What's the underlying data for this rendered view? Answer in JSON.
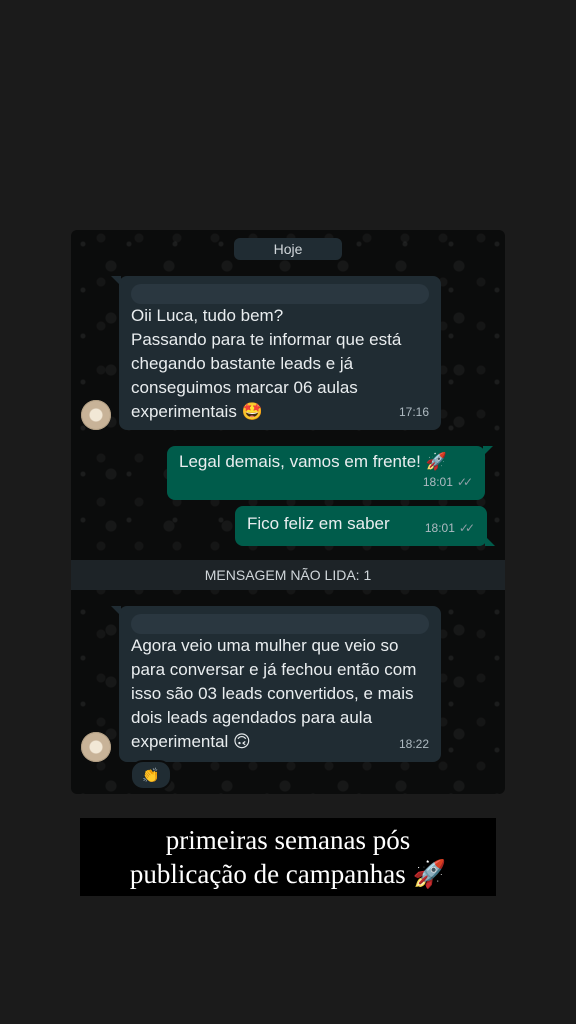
{
  "chat": {
    "date_label": "Hoje",
    "messages": [
      {
        "direction": "incoming",
        "text": "Oii Luca, tudo bem?\nPassando para te informar que está chegando bastante leads e já conseguimos marcar 06 aulas experimentais 🤩",
        "time": "17:16"
      },
      {
        "direction": "outgoing",
        "text": "Legal demais, vamos em frente! 🚀",
        "time": "18:01",
        "status": "read"
      },
      {
        "direction": "outgoing",
        "text": "Fico feliz em saber",
        "time": "18:01",
        "status": "read"
      }
    ],
    "unread_label": "MENSAGEM NÃO LIDA: 1",
    "unread_message": {
      "direction": "incoming",
      "text": "Agora veio uma mulher que veio so para conversar e já fechou então com isso são 03 leads convertidos, e mais dois leads agendados para aula experimental 🙃",
      "time": "18:22",
      "reaction": "👏"
    }
  },
  "caption": {
    "line1": "primeiras semanas pós",
    "line2": "publicação de campanhas 🚀"
  },
  "colors": {
    "incoming_bubble": "#202c33",
    "outgoing_bubble": "#005c4b",
    "chat_bg": "#0b0c0c",
    "page_bg": "#1b1b1b"
  }
}
